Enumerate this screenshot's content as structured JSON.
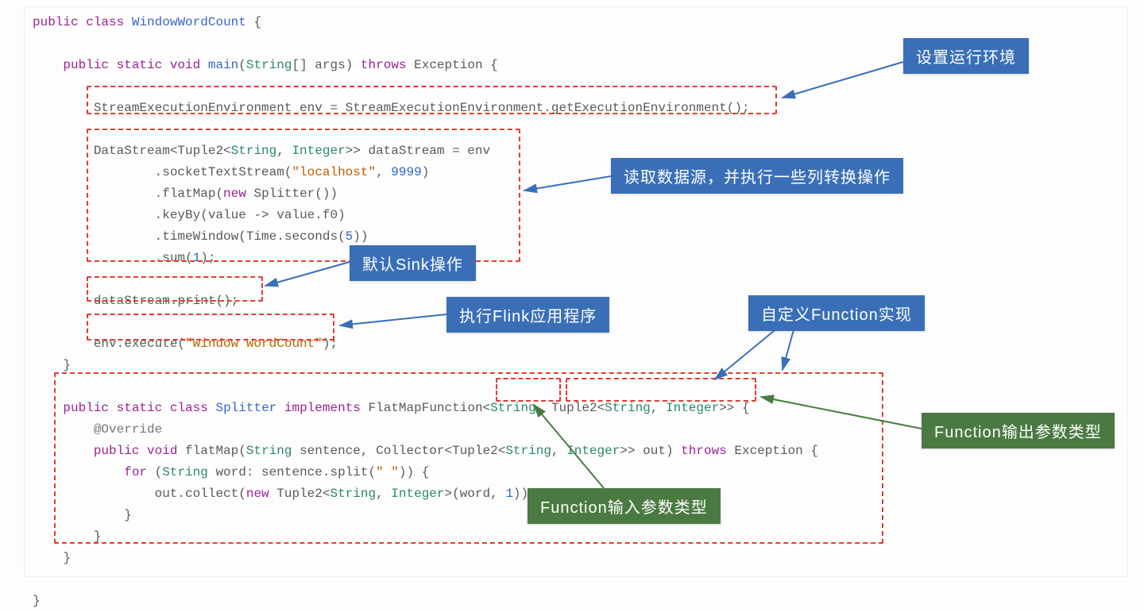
{
  "code": {
    "l1_public": "public",
    "l1_class": "class",
    "l1_name": "WindowWordCount",
    "l1_brace": "{",
    "l3_public": "public",
    "l3_static": "static",
    "l3_void": "void",
    "l3_main": "main",
    "l3_stringarr": "String",
    "l3_args": "[] args)",
    "l3_throws": "throws",
    "l3_exc": "Exception {",
    "l5": "StreamExecutionEnvironment env = StreamExecutionEnvironment.getExecutionEnvironment();",
    "l7a": "DataStream<Tuple2<",
    "l7_str": "String",
    "l7_c": ", ",
    "l7_int": "Integer",
    "l7b": ">> dataStream = env",
    "l8a": ".socketTextStream(",
    "l8_loc": "\"localhost\"",
    "l8b": ", ",
    "l8_num": "9999",
    "l8c": ")",
    "l9a": ".flatMap(",
    "l9_new": "new",
    "l9b": " Splitter())",
    "l10a": ".keyBy(value ",
    "l10_arrow": "->",
    "l10b": " value.f0)",
    "l11a": ".timeWindow(Time.seconds(",
    "l11_num": "5",
    "l11b": "))",
    "l12a": ".sum(",
    "l12_num": "1",
    "l12b": ");",
    "l14": "dataStream.print();",
    "l16a": "env.execute(",
    "l16_str": "\"Window WordCount\"",
    "l16b": ");",
    "l17": "}",
    "l19_public": "public",
    "l19_static": "static",
    "l19_class": "class",
    "l19_name": "Splitter",
    "l19_impl": "implements",
    "l19_fm": "FlatMapFunction<",
    "l19_s1": "String",
    "l19_c1": ", Tuple2<",
    "l19_s2": "String",
    "l19_c2": ", ",
    "l19_i": "Integer",
    "l19_end": ">> {",
    "l20": "@Override",
    "l21_public": "public",
    "l21_void": "void",
    "l21a": " flatMap(",
    "l21_str": "String",
    "l21b": " sentence, Collector<Tuple2<",
    "l21_s2": "String",
    "l21_c": ", ",
    "l21_i": "Integer",
    "l21d": ">> out) ",
    "l21_throws": "throws",
    "l21e": " Exception {",
    "l22_for": "for",
    "l22a": " (",
    "l22_str": "String",
    "l22b": " word: sentence.split(",
    "l22_sp": "\" \"",
    "l22c": ")) {",
    "l23a": "out.collect(",
    "l23_new": "new",
    "l23b": " Tuple2<",
    "l23_s": "String",
    "l23_c": ", ",
    "l23_i": "Integer",
    "l23d": ">(word, ",
    "l23_num": "1",
    "l23e": "));",
    "l24": "}",
    "l25": "}",
    "l26": "}"
  },
  "labels": {
    "env": "设置运行环境",
    "datasource": "读取数据源，并执行一些列转换操作",
    "sink": "默认Sink操作",
    "execute": "执行Flink应用程序",
    "custom_fn": "自定义Function实现",
    "fn_output": "Function输出参数类型",
    "fn_input": "Function输入参数类型"
  }
}
